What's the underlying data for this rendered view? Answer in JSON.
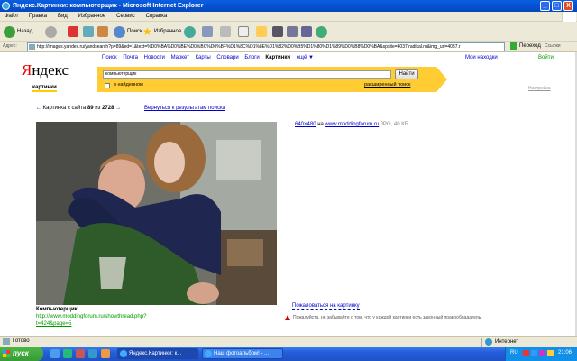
{
  "window": {
    "title": "Яндекс.Картинки: компьютерщик - Microsoft Internet Explorer",
    "controls": [
      "_",
      "□",
      "X"
    ]
  },
  "menu": [
    "Файл",
    "Правка",
    "Вид",
    "Избранное",
    "Сервис",
    "Справка"
  ],
  "toolbar": {
    "back_label": "Назад",
    "search_label": "Поиск",
    "favorites_label": "Избранное"
  },
  "address": {
    "label": "Адрес:",
    "url": "http://images.yandex.ru/yandsearch?p=89&ed=1&text=%D0%BA%D0%BE%D0%BC%D0%BF%D1%8C%D1%8E%D1%82%D0%B5%D1%80%D1%89%D0%B8%D0%BA&spsite=4037.radikal.ru&img_url=4037.r",
    "go_label": "Переход",
    "links_label": "Ссылки"
  },
  "nav": {
    "items": [
      "Поиск",
      "Почта",
      "Новости",
      "Маркет",
      "Карты",
      "Словари",
      "Блоги",
      "Картинки",
      "ещё ▼"
    ],
    "find_link": "Мои находки",
    "login_link": "Войти",
    "settings_link": "Настройка"
  },
  "logo": {
    "ya": "Я",
    "rest": "ндекс",
    "sub": "картинки"
  },
  "search": {
    "query": "компьютерщик",
    "button": "Найти",
    "found_label": "в найденном",
    "advanced_link": "расширенный поиск"
  },
  "result": {
    "counter_prefix": "Картинка с сайта",
    "index": "89",
    "of": "из",
    "total": "2728",
    "back_link": "Вернуться к результатам поиска",
    "size_link": "640×480",
    "on": "на",
    "site_link": "www.moddingforum.ru",
    "meta": "JPG, 40 КБ",
    "caption_title": "Компьютерщик",
    "caption_url_1": "http://www.moddingforum.ru/showthread.php?",
    "caption_url_2": "t=424&page=5",
    "complain_link": "Пожаловаться на картинку",
    "notice": "Пожалуйста, не забывайте о том, что у каждой картинки есть законный правообладатель."
  },
  "status": {
    "text": "Готово",
    "zone": "Интернет"
  },
  "taskbar": {
    "start": "пуск",
    "tasks": [
      "Яндекс.Картинки: к...",
      "Наш фотоальбом! - ..."
    ],
    "lang": "RU",
    "clock": "21:06"
  }
}
